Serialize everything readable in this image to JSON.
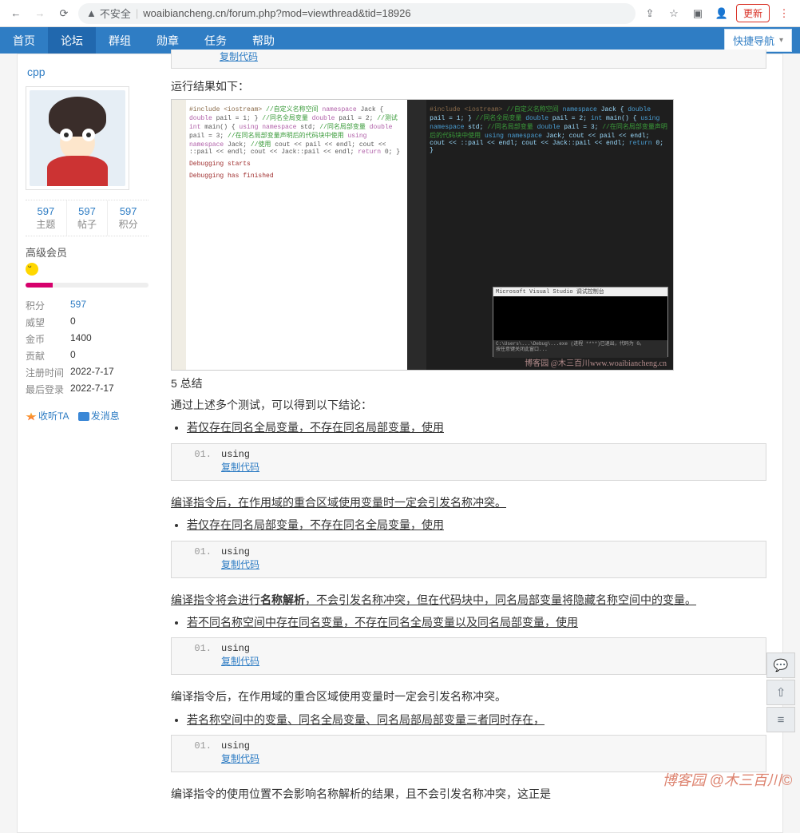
{
  "browser": {
    "insecure_label": "不安全",
    "url": "woaibiancheng.cn/forum.php?mod=viewthread&tid=18926",
    "update_label": "更新"
  },
  "topnav": {
    "items": [
      "首页",
      "论坛",
      "群组",
      "勋章",
      "任务",
      "帮助"
    ],
    "active_index": 1,
    "quick_nav": "快捷导航"
  },
  "sidebar": {
    "username": "cpp",
    "stats": [
      {
        "num": "597",
        "lbl": "主题"
      },
      {
        "num": "597",
        "lbl": "帖子"
      },
      {
        "num": "597",
        "lbl": "积分"
      }
    ],
    "rank": "高级会员",
    "info": [
      {
        "k": "积分",
        "v": "597",
        "blue": true
      },
      {
        "k": "威望",
        "v": "0"
      },
      {
        "k": "金币",
        "v": "1400"
      },
      {
        "k": "贡献",
        "v": "0"
      },
      {
        "k": "注册时间",
        "v": "2022-7-17"
      },
      {
        "k": "最后登录",
        "v": "2022-7-17"
      }
    ],
    "action_fav": "收听TA",
    "action_msg": "发消息"
  },
  "post": {
    "top_copy": "复制代码",
    "result_header": "运行结果如下：",
    "section5": "5 总结",
    "intro": "通过上述多个测试，可以得到以下结论：",
    "bullet1": "若仅存在同名全局变量，不存在同名局部变量，使用",
    "code_kw": "using",
    "copy_label": "复制代码",
    "para1": "编译指令后，在作用域的重合区域使用变量时一定会引发名称冲突。",
    "bullet2": "若仅存在同名局部变量，不存在同名全局变量，使用",
    "para2a": "编译指令将会进行",
    "para2b": "名称解析",
    "para2c": "，不会引发名称冲突，但在代码块中，同名局部变量将隐藏名称空间中的变量。",
    "bullet3": "若不同名称空间中存在同名变量，不存在同名全局变量以及同名局部变量，使用",
    "para3": "编译指令后，在作用域的重合区域使用变量时一定会引发名称冲突。",
    "bullet4": "若名称空间中的变量、同名全局变量、同名局部局部变量三者同时存在，",
    "para4": "编译指令的使用位置不会影响名称解析的结果，且不会引发名称冲突，这正是",
    "shot_watermark": "博客园 @木三百川www.woaibiancheng.cn",
    "console_title": "Microsoft Visual Studio 调试控制台"
  },
  "footer_watermark": "博客园 @木三百川©"
}
